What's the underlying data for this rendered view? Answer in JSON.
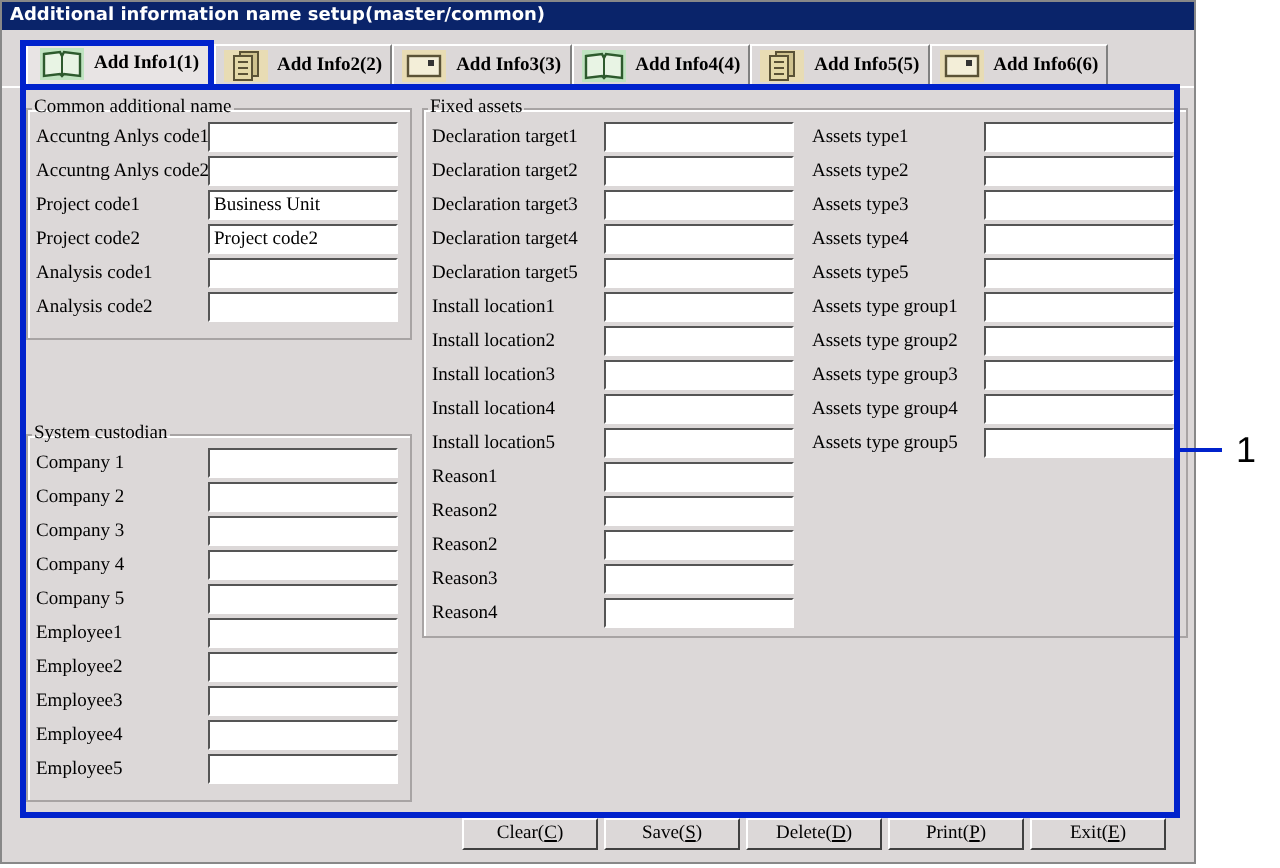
{
  "window": {
    "title": "Additional information name setup(master/common)"
  },
  "tabs": [
    {
      "label": "Add Info1(1)",
      "kind": "book",
      "selected": true
    },
    {
      "label": "Add Info2(2)",
      "kind": "pages",
      "selected": false
    },
    {
      "label": "Add Info3(3)",
      "kind": "card",
      "selected": false
    },
    {
      "label": "Add Info4(4)",
      "kind": "book",
      "selected": false
    },
    {
      "label": "Add Info5(5)",
      "kind": "pages",
      "selected": false
    },
    {
      "label": "Add Info6(6)",
      "kind": "card",
      "selected": false
    }
  ],
  "groups": [
    {
      "title": "Common additional name",
      "fields": [
        {
          "label": "Accuntng Anlys code1"
        },
        {
          "label": "Accuntng Anlys code2"
        },
        {
          "label": "Project code1",
          "value": "Business Unit"
        },
        {
          "label": "Project code2",
          "value": "Project code2"
        },
        {
          "label": "Analysis code1"
        },
        {
          "label": "Analysis code2"
        }
      ]
    },
    {
      "title": "System custodian",
      "fields": [
        {
          "label": "Company 1"
        },
        {
          "label": "Company 2"
        },
        {
          "label": "Company 3"
        },
        {
          "label": "Company 4"
        },
        {
          "label": "Company 5"
        },
        {
          "label": "Employee1"
        },
        {
          "label": "Employee2"
        },
        {
          "label": "Employee3"
        },
        {
          "label": "Employee4"
        },
        {
          "label": "Employee5"
        }
      ]
    }
  ],
  "fixed_assets": {
    "title": "Fixed assets",
    "columns": [
      [
        {
          "label": "Declaration target1"
        },
        {
          "label": "Declaration target2"
        },
        {
          "label": "Declaration target3"
        },
        {
          "label": "Declaration target4"
        },
        {
          "label": "Declaration target5"
        },
        {
          "label": "Install location1"
        },
        {
          "label": "Install location2"
        },
        {
          "label": "Install location3"
        },
        {
          "label": "Install location4"
        },
        {
          "label": "Install location5"
        },
        {
          "label": "Reason1"
        },
        {
          "label": "Reason2"
        },
        {
          "label": "Reason2"
        },
        {
          "label": "Reason3"
        },
        {
          "label": "Reason4"
        }
      ],
      [
        {
          "label": "Assets type1"
        },
        {
          "label": "Assets type2"
        },
        {
          "label": "Assets type3"
        },
        {
          "label": "Assets type4"
        },
        {
          "label": "Assets type5"
        },
        {
          "label": "Assets type group1"
        },
        {
          "label": "Assets type group2"
        },
        {
          "label": "Assets type group3"
        },
        {
          "label": "Assets type group4"
        },
        {
          "label": "Assets type group5"
        }
      ]
    ]
  },
  "buttons": [
    {
      "before": "Clear(",
      "key": "C",
      "after": ")"
    },
    {
      "before": "Save(",
      "key": "S",
      "after": ")"
    },
    {
      "before": "Delete(",
      "key": "D",
      "after": ")"
    },
    {
      "before": "Print(",
      "key": "P",
      "after": ")"
    },
    {
      "before": "Exit(",
      "key": "E",
      "after": ")"
    }
  ],
  "callout": {
    "number": "1"
  }
}
